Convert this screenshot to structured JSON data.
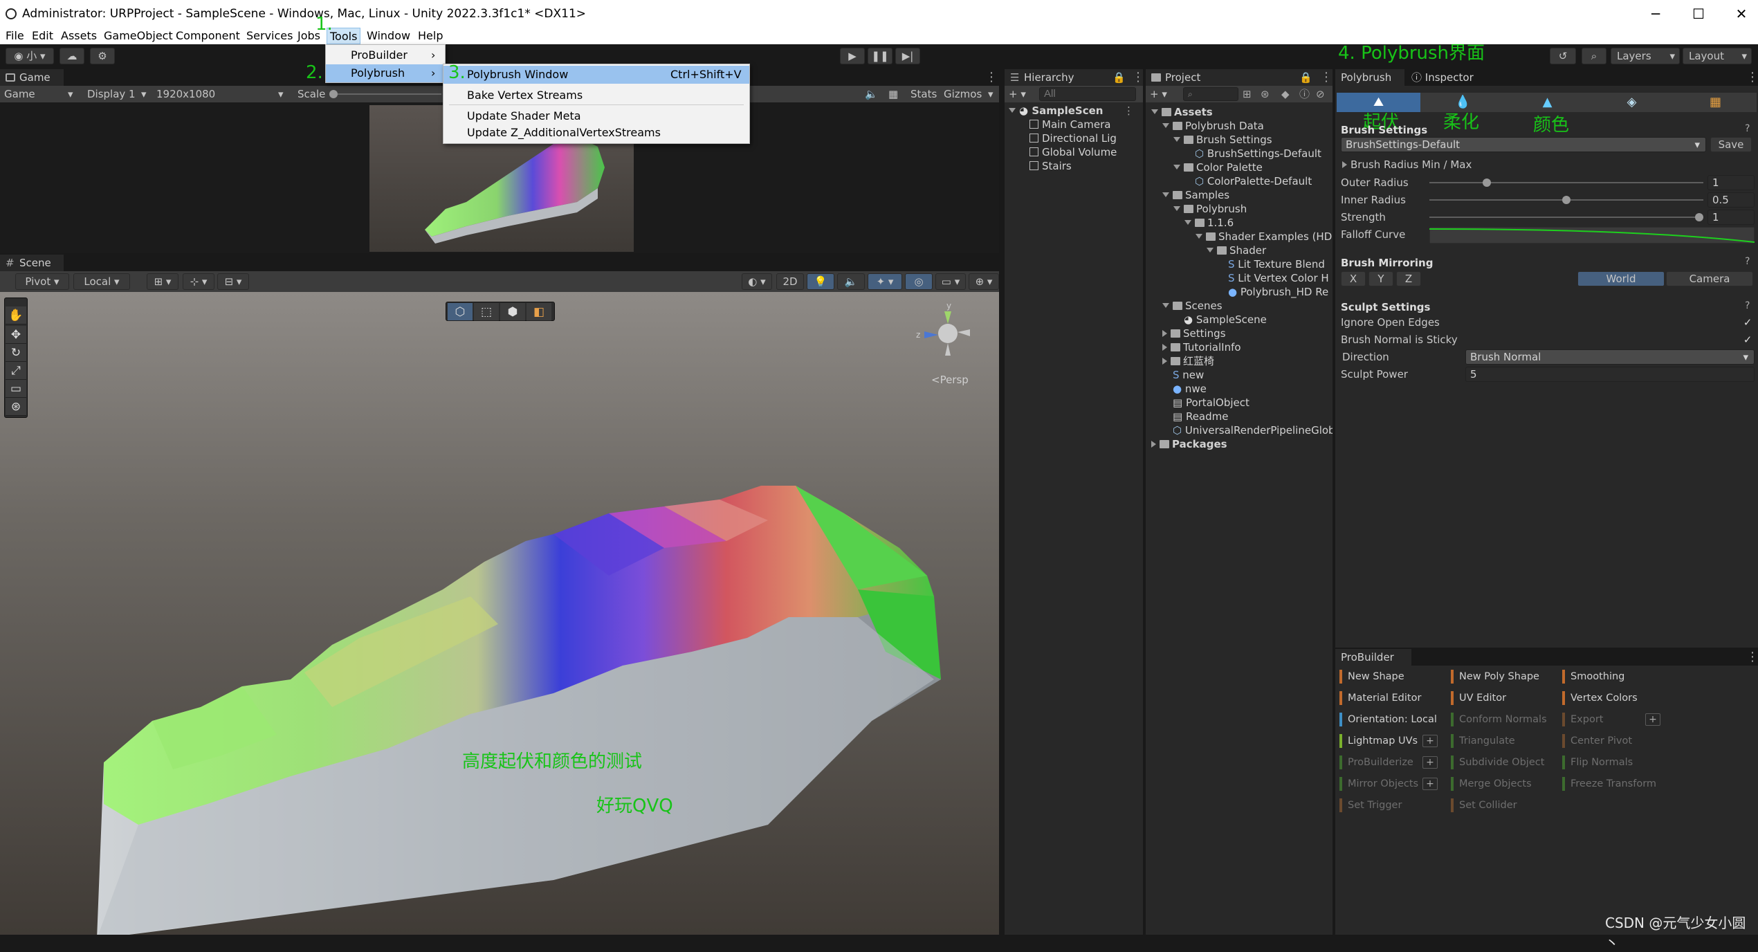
{
  "window": {
    "title": "Administrator: URPProject - SampleScene - Windows, Mac, Linux - Unity 2022.3.3f1c1* <DX11>"
  },
  "menubar": [
    "File",
    "Edit",
    "Assets",
    "GameObject",
    "Component",
    "Services",
    "Jobs",
    "Tools",
    "Window",
    "Help"
  ],
  "toolbar": {
    "account": "小",
    "layers_label": "Layers",
    "layout_label": "Layout"
  },
  "game": {
    "tab": "Game",
    "display_mode": "Game",
    "display": "Display 1",
    "resolution": "1920x1080",
    "scale_label": "Scale",
    "stats": "Stats",
    "gizmos": "Gizmos"
  },
  "tools_menu": {
    "items": [
      "ProBuilder",
      "Polybrush"
    ]
  },
  "polybrush_submenu": {
    "items": [
      {
        "label": "Polybrush Window",
        "shortcut": "Ctrl+Shift+V"
      },
      {
        "label": "Bake Vertex Streams",
        "shortcut": ""
      },
      {
        "label": "Update Shader Meta",
        "shortcut": ""
      },
      {
        "label": "Update Z_AdditionalVertexStreams",
        "shortcut": ""
      }
    ]
  },
  "scene": {
    "tab": "Scene",
    "pivot": "Pivot",
    "local": "Local",
    "mode2d": "2D",
    "persp": "<Persp"
  },
  "hierarchy": {
    "tab": "Hierarchy",
    "search_placeholder": "All",
    "scene_name": "SampleScen",
    "items": [
      "Main Camera",
      "Directional Lig",
      "Global Volume",
      "Stairs"
    ]
  },
  "project": {
    "tab": "Project",
    "tree": [
      {
        "label": "Assets",
        "depth": 0,
        "kind": "folder-open",
        "bold": true
      },
      {
        "label": "Polybrush Data",
        "depth": 1,
        "kind": "folder-open"
      },
      {
        "label": "Brush Settings",
        "depth": 2,
        "kind": "folder-open"
      },
      {
        "label": "BrushSettings-Default",
        "depth": 3,
        "kind": "asset"
      },
      {
        "label": "Color Palette",
        "depth": 2,
        "kind": "folder-open"
      },
      {
        "label": "ColorPalette-Default",
        "depth": 3,
        "kind": "asset"
      },
      {
        "label": "Samples",
        "depth": 1,
        "kind": "folder-open"
      },
      {
        "label": "Polybrush",
        "depth": 2,
        "kind": "folder-open"
      },
      {
        "label": "1.1.6",
        "depth": 3,
        "kind": "folder-open"
      },
      {
        "label": "Shader Examples (HDI",
        "depth": 4,
        "kind": "folder-open"
      },
      {
        "label": "Shader",
        "depth": 5,
        "kind": "folder-open"
      },
      {
        "label": "Lit Texture Blend",
        "depth": 6,
        "kind": "shader"
      },
      {
        "label": "Lit Vertex Color H",
        "depth": 6,
        "kind": "shader"
      },
      {
        "label": "Polybrush_HD Re",
        "depth": 6,
        "kind": "material"
      },
      {
        "label": "Scenes",
        "depth": 1,
        "kind": "folder-open"
      },
      {
        "label": "SampleScene",
        "depth": 2,
        "kind": "scene"
      },
      {
        "label": "Settings",
        "depth": 1,
        "kind": "folder"
      },
      {
        "label": "TutorialInfo",
        "depth": 1,
        "kind": "folder"
      },
      {
        "label": "红蓝椅",
        "depth": 1,
        "kind": "folder"
      },
      {
        "label": "new",
        "depth": 1,
        "kind": "shader"
      },
      {
        "label": "nwe",
        "depth": 1,
        "kind": "material"
      },
      {
        "label": "PortalObject",
        "depth": 1,
        "kind": "doc"
      },
      {
        "label": "Readme",
        "depth": 1,
        "kind": "doc"
      },
      {
        "label": "UniversalRenderPipelineGlob",
        "depth": 1,
        "kind": "asset"
      },
      {
        "label": "Packages",
        "depth": 0,
        "kind": "folder",
        "bold": true
      }
    ]
  },
  "polybrush": {
    "tab": "Polybrush",
    "inspector_tab": "Inspector",
    "brush_settings_title": "Brush Settings",
    "preset": "BrushSettings-Default",
    "save": "Save",
    "radius_foldout": "Brush Radius Min / Max",
    "params": [
      {
        "label": "Outer Radius",
        "value": "1",
        "fraction": 0.2
      },
      {
        "label": "Inner Radius",
        "value": "0.5",
        "fraction": 0.5
      },
      {
        "label": "Strength",
        "value": "1",
        "fraction": 1.0
      }
    ],
    "falloff_label": "Falloff Curve",
    "mirroring_title": "Brush Mirroring",
    "axes": [
      "X",
      "Y",
      "Z"
    ],
    "space_world": "World",
    "space_camera": "Camera",
    "sculpt_title": "Sculpt Settings",
    "ignore_open_edges": "Ignore Open Edges",
    "normal_sticky": "Brush Normal is Sticky",
    "direction_label": "Direction",
    "direction_value": "Brush Normal",
    "power_label": "Sculpt Power",
    "power_value": "5"
  },
  "probuilder": {
    "tab": "ProBuilder",
    "buttons": [
      {
        "label": "New Shape",
        "color": "#c16a2c",
        "enabled": true,
        "plus": false
      },
      {
        "label": "New Poly Shape",
        "color": "#c16a2c",
        "enabled": true,
        "plus": false
      },
      {
        "label": "Smoothing",
        "color": "#c16a2c",
        "enabled": true,
        "plus": false
      },
      {
        "label": "Material Editor",
        "color": "#c16a2c",
        "enabled": true,
        "plus": false
      },
      {
        "label": "UV Editor",
        "color": "#c16a2c",
        "enabled": true,
        "plus": false
      },
      {
        "label": "Vertex Colors",
        "color": "#c16a2c",
        "enabled": true,
        "plus": false
      },
      {
        "label": "Orientation: Local",
        "color": "#3d8fc6",
        "enabled": true,
        "plus": false
      },
      {
        "label": "Conform Normals",
        "color": "#3c6b2e",
        "enabled": false,
        "plus": false
      },
      {
        "label": "Export",
        "color": "#6b4a2e",
        "enabled": false,
        "plus": true
      },
      {
        "label": "Lightmap UVs",
        "color": "#7ab02c",
        "enabled": true,
        "plus": true
      },
      {
        "label": "Triangulate",
        "color": "#3c6b2e",
        "enabled": false,
        "plus": false
      },
      {
        "label": "Center Pivot",
        "color": "#6b4a2e",
        "enabled": false,
        "plus": false
      },
      {
        "label": "ProBuilderize",
        "color": "#3c6b2e",
        "enabled": false,
        "plus": true
      },
      {
        "label": "Subdivide Object",
        "color": "#3c6b2e",
        "enabled": false,
        "plus": false
      },
      {
        "label": "Flip Normals",
        "color": "#3c6b2e",
        "enabled": false,
        "plus": false
      },
      {
        "label": "Mirror Objects",
        "color": "#3c6b2e",
        "enabled": false,
        "plus": true
      },
      {
        "label": "Merge Objects",
        "color": "#3c6b2e",
        "enabled": false,
        "plus": false
      },
      {
        "label": "Freeze Transform",
        "color": "#3c6b2e",
        "enabled": false,
        "plus": false
      },
      {
        "label": "Set Trigger",
        "color": "#6b4a2e",
        "enabled": false,
        "plus": false
      },
      {
        "label": "Set Collider",
        "color": "#6b4a2e",
        "enabled": false,
        "plus": false
      }
    ]
  },
  "annotations": {
    "step1": "1.",
    "step2": "2.",
    "step3": "3.",
    "step4": "4. Polybrush界面",
    "tool_raise": "起伏",
    "tool_smooth": "柔化",
    "tool_color": "颜色",
    "scene_text1": "高度起伏和颜色的测试",
    "scene_text2": "好玩QVQ"
  },
  "watermark": "CSDN @元气少女小圆丶",
  "colors": {
    "accent_green": "#18c318",
    "selected_menu": "#99c2ee",
    "world_active": "#46607f"
  }
}
